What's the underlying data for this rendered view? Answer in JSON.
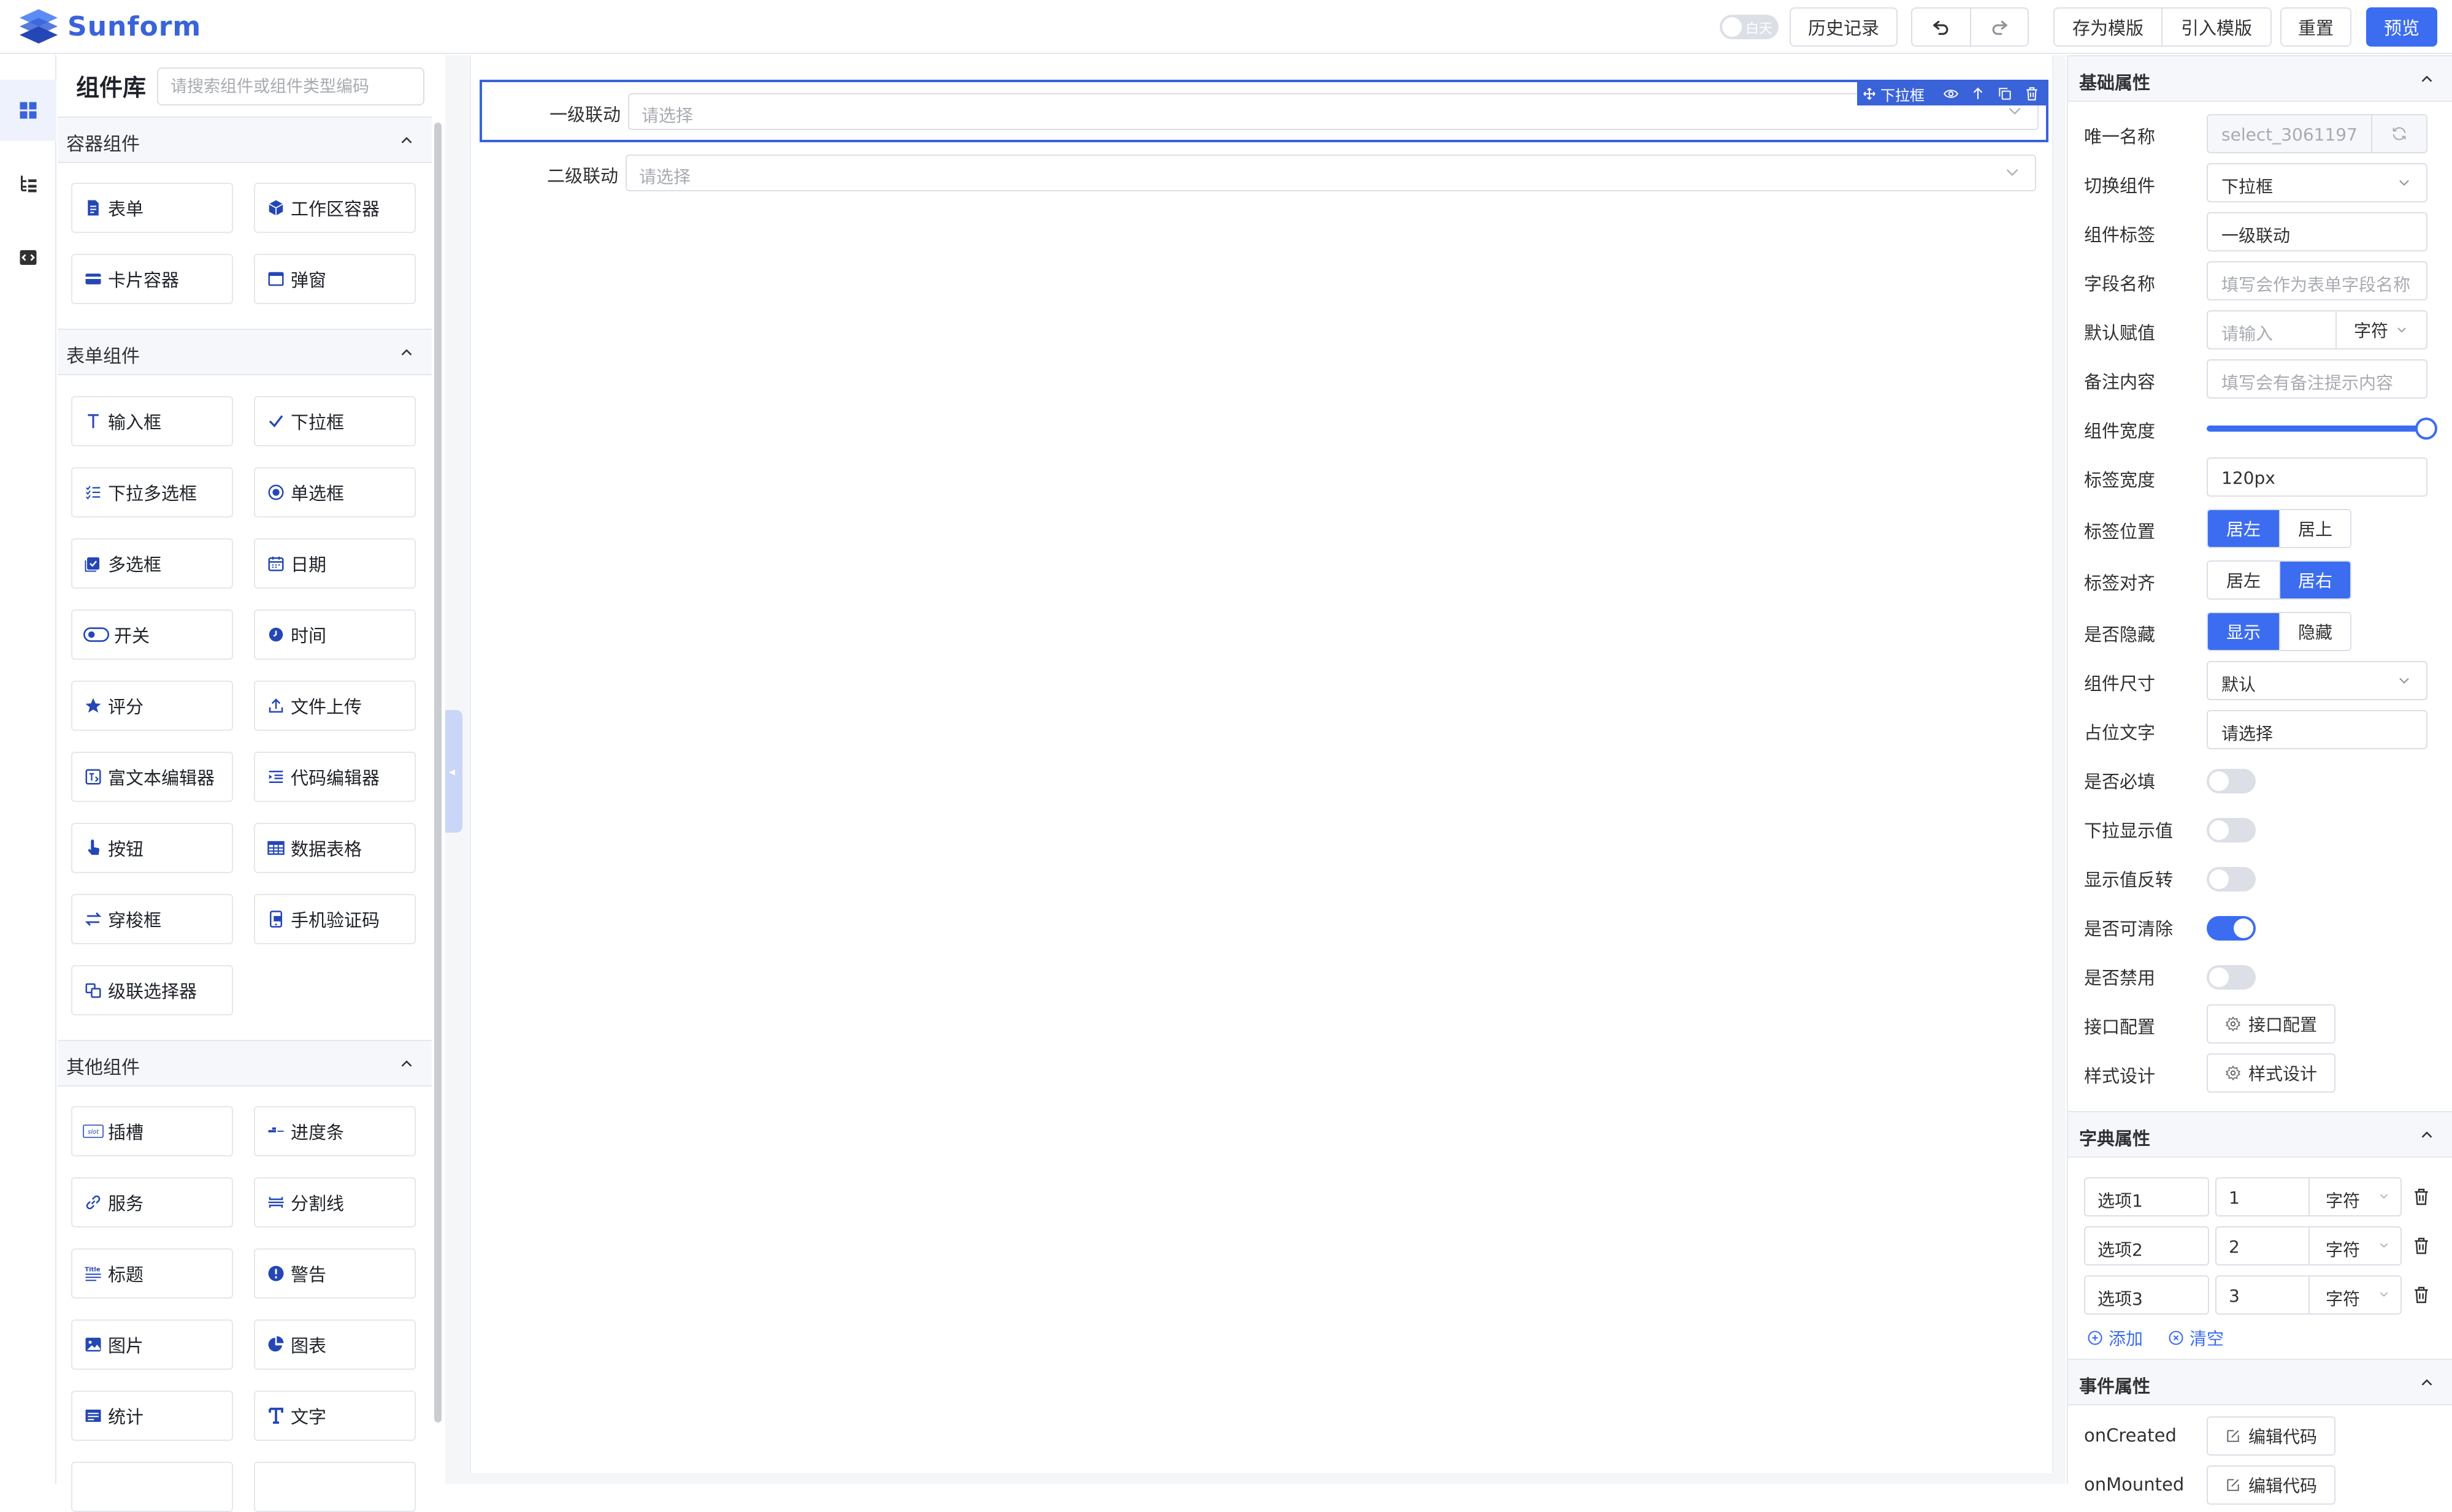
{
  "header": {
    "brand": "Sunform",
    "theme_toggle_label": "白天",
    "history_label": "历史记录",
    "save_template_label": "存为模版",
    "import_template_label": "引入模版",
    "reset_label": "重置",
    "preview_label": "预览"
  },
  "library": {
    "title": "组件库",
    "search_placeholder": "请搜索组件或组件类型编码",
    "sections": [
      {
        "title": "容器组件",
        "items": [
          "表单",
          "工作区容器",
          "卡片容器",
          "弹窗"
        ]
      },
      {
        "title": "表单组件",
        "items": [
          "输入框",
          "下拉框",
          "下拉多选框",
          "单选框",
          "多选框",
          "日期",
          "开关",
          "时间",
          "评分",
          "文件上传",
          "富文本编辑器",
          "代码编辑器",
          "按钮",
          "数据表格",
          "穿梭框",
          "手机验证码",
          "级联选择器"
        ]
      },
      {
        "title": "其他组件",
        "items": [
          "插槽",
          "进度条",
          "服务",
          "分割线",
          "标题",
          "警告",
          "图片",
          "图表",
          "统计",
          "文字"
        ]
      }
    ]
  },
  "canvas": {
    "fields": [
      {
        "label": "一级联动",
        "placeholder": "请选择",
        "selected": true
      },
      {
        "label": "二级联动",
        "placeholder": "请选择",
        "selected": false
      }
    ],
    "toolbar_tag": "下拉框"
  },
  "props": {
    "basic_title": "基础属性",
    "rows": {
      "unique_name": {
        "label": "唯一名称",
        "value": "select_3061197"
      },
      "switch_comp": {
        "label": "切换组件",
        "value": "下拉框"
      },
      "comp_label": {
        "label": "组件标签",
        "value": "一级联动"
      },
      "field_name": {
        "label": "字段名称",
        "placeholder": "填写会作为表单字段名称"
      },
      "default_value": {
        "label": "默认赋值",
        "placeholder": "请输入",
        "type": "字符"
      },
      "remark": {
        "label": "备注内容",
        "placeholder": "填写会有备注提示内容"
      },
      "comp_width": {
        "label": "组件宽度",
        "value_percent": 100
      },
      "label_width": {
        "label": "标签宽度",
        "value": "120px"
      },
      "label_pos": {
        "label": "标签位置",
        "opt1": "居左",
        "opt2": "居上"
      },
      "label_align": {
        "label": "标签对齐",
        "opt1": "居左",
        "opt2": "居右"
      },
      "hidden": {
        "label": "是否隐藏",
        "opt1": "显示",
        "opt2": "隐藏"
      },
      "size": {
        "label": "组件尺寸",
        "value": "默认"
      },
      "placeholder_text": {
        "label": "占位文字",
        "value": "请选择"
      },
      "required": {
        "label": "是否必填",
        "on": false
      },
      "show_value": {
        "label": "下拉显示值",
        "on": false
      },
      "reverse": {
        "label": "显示值反转",
        "on": false
      },
      "clearable": {
        "label": "是否可清除",
        "on": true
      },
      "disabled": {
        "label": "是否禁用",
        "on": false
      },
      "api": {
        "label": "接口配置",
        "button": "接口配置"
      },
      "style": {
        "label": "样式设计",
        "button": "样式设计"
      }
    },
    "dict_title": "字典属性",
    "dict": [
      {
        "label": "选项1",
        "value": "1",
        "type": "字符"
      },
      {
        "label": "选项2",
        "value": "2",
        "type": "字符"
      },
      {
        "label": "选项3",
        "value": "3",
        "type": "字符"
      }
    ],
    "dict_add": "添加",
    "dict_clear": "清空",
    "event_title": "事件属性",
    "events": [
      {
        "label": "onCreated",
        "button": "编辑代码"
      },
      {
        "label": "onMounted",
        "button": "编辑代码"
      }
    ]
  },
  "colors": {
    "accent": "#3c6df0",
    "brand": "#3a63d9"
  }
}
